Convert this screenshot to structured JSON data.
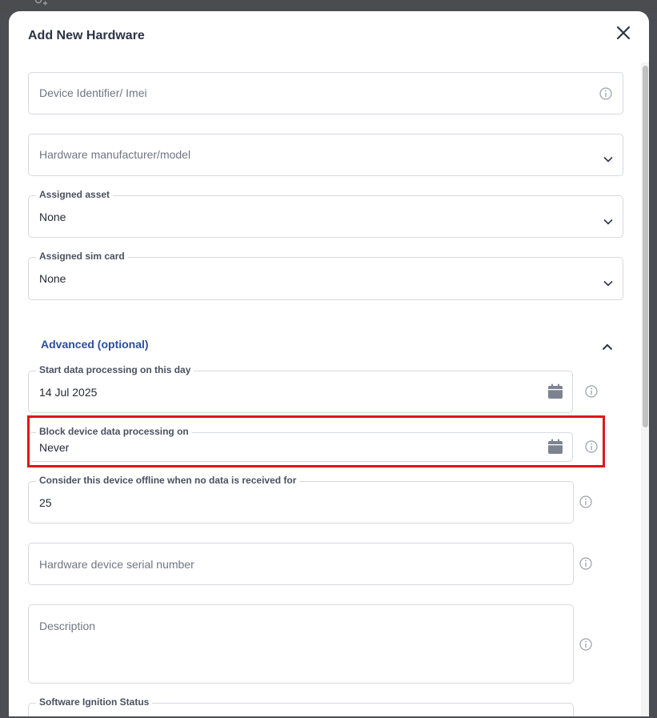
{
  "dialog": {
    "title": "Add New Hardware",
    "close_icon": "close-icon"
  },
  "fields": {
    "imei": {
      "placeholder": "Device Identifier/ Imei",
      "icon": "info-icon"
    },
    "model": {
      "placeholder": "Hardware manufacturer/model",
      "icon": "chevron-down-icon"
    },
    "asset": {
      "label": "Assigned asset",
      "value": "None",
      "icon": "chevron-down-icon"
    },
    "sim": {
      "label": "Assigned sim card",
      "value": "None",
      "icon": "chevron-down-icon"
    }
  },
  "advanced": {
    "title": "Advanced (optional)",
    "expanded": true,
    "icon": "chevron-up-icon",
    "start_date": {
      "label": "Start data processing on this day",
      "value": "14 Jul 2025",
      "icon": "calendar-icon"
    },
    "block_date": {
      "label": "Block device data processing on",
      "value": "Never",
      "icon": "calendar-icon",
      "highlighted": true
    },
    "offline": {
      "label": "Consider this device offline when no data is received for",
      "value": "25"
    },
    "serial": {
      "placeholder": "Hardware device serial number"
    },
    "description": {
      "placeholder": "Description"
    },
    "ignition": {
      "label": "Software Ignition Status"
    }
  },
  "colors": {
    "accent": "#2a4ea1",
    "highlight": "#e0161b",
    "backdrop": "#4b4d52"
  }
}
